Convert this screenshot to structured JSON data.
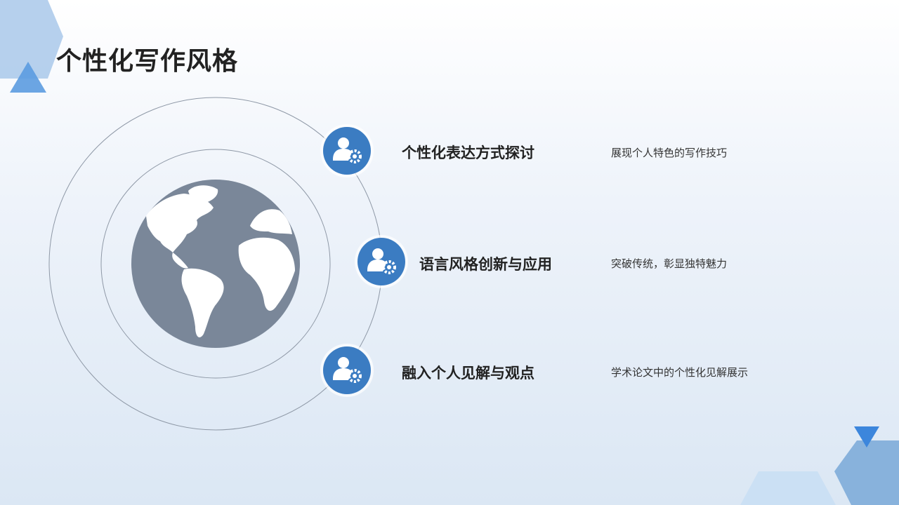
{
  "slide": {
    "title": "个性化写作风格"
  },
  "items": [
    {
      "title": "个性化表达方式探讨",
      "desc": "展现个人特色的写作技巧"
    },
    {
      "title": "语言风格创新与应用",
      "desc": "突破传统，彰显独特魅力"
    },
    {
      "title": "融入个人见解与观点",
      "desc": "学术论文中的个性化见解展示"
    }
  ],
  "colors": {
    "accent": "#3b7cc2",
    "globe": "#7a8799",
    "deco_light": "#a9c8ea",
    "deco_mid": "#6fa6de"
  },
  "icons": [
    "globe-icon",
    "user-gear-icon",
    "triangle-icon",
    "hexagon-icon"
  ]
}
